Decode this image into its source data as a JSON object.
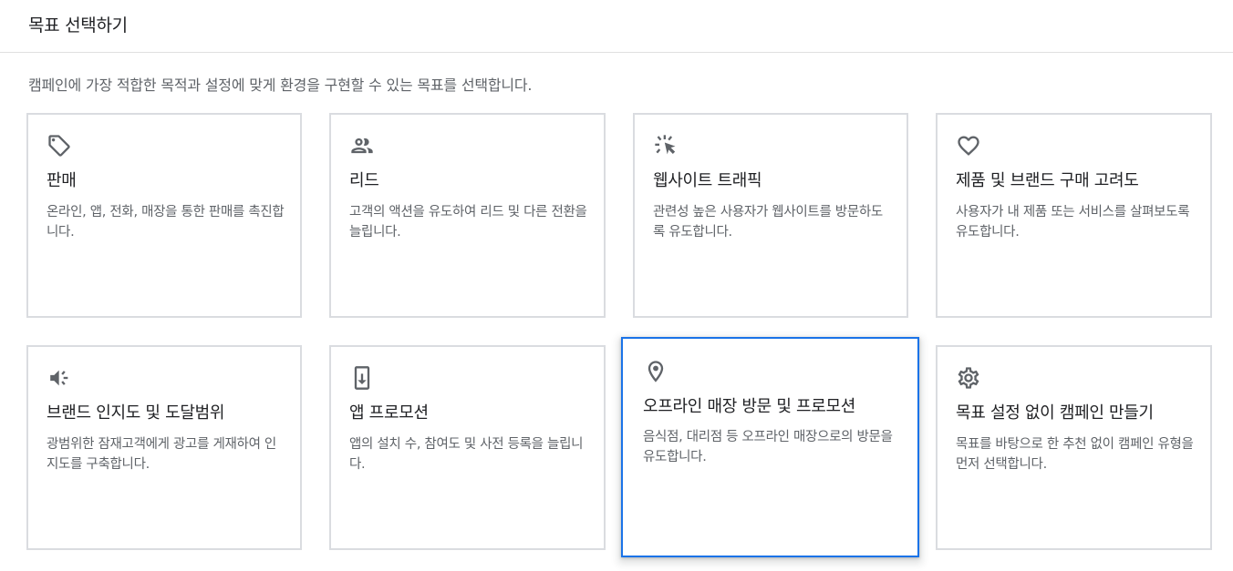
{
  "header": {
    "title": "목표 선택하기"
  },
  "subtitle": "캠페인에 가장 적합한 목적과 설정에 맞게 환경을 구현할 수 있는 목표를 선택합니다.",
  "goals": [
    {
      "title": "판매",
      "desc": "온라인, 앱, 전화, 매장을 통한 판매를 촉진합니다.",
      "icon": "tag-icon"
    },
    {
      "title": "리드",
      "desc": "고객의 액션을 유도하여 리드 및 다른 전환을 늘립니다.",
      "icon": "people-icon"
    },
    {
      "title": "웹사이트 트래픽",
      "desc": "관련성 높은 사용자가 웹사이트를 방문하도록 유도합니다.",
      "icon": "cursor-click-icon"
    },
    {
      "title": "제품 및 브랜드 구매 고려도",
      "desc": "사용자가 내 제품 또는 서비스를 살펴보도록 유도합니다.",
      "icon": "heart-icon"
    },
    {
      "title": "브랜드 인지도 및 도달범위",
      "desc": "광범위한 잠재고객에게 광고를 게재하여 인지도를 구축합니다.",
      "icon": "megaphone-icon"
    },
    {
      "title": "앱 프로모션",
      "desc": "앱의 설치 수, 참여도 및 사전 등록을 늘립니다.",
      "icon": "phone-download-icon"
    },
    {
      "title": "오프라인 매장 방문 및 프로모션",
      "desc": "음식점, 대리점 등 오프라인 매장으로의 방문을 유도합니다.",
      "icon": "location-pin-icon"
    },
    {
      "title": "목표 설정 없이 캠페인 만들기",
      "desc": "목표를 바탕으로 한 추천 없이 캠페인 유형을 먼저 선택합니다.",
      "icon": "gear-icon"
    }
  ],
  "colors": {
    "selected_border": "#1a73e8",
    "card_border": "#dadce0",
    "icon": "#5f6368"
  }
}
